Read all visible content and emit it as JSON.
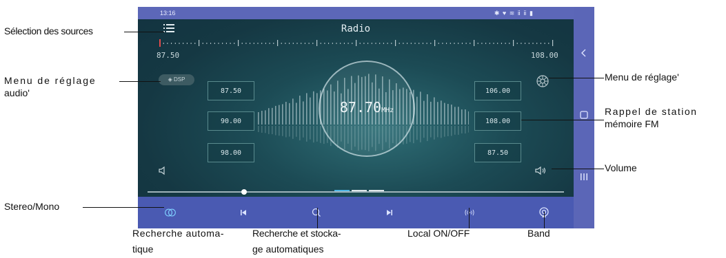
{
  "status": {
    "time": "13:16",
    "icons": "✱ ♥ ≋ ⅱ ⅱ ▮"
  },
  "app": {
    "title": "Radio",
    "scale_min": "87.50",
    "scale_max": "108.00",
    "dsp_label": "DSP",
    "frequency": "87.70",
    "frequency_unit": "MHz"
  },
  "presets_left": [
    "87.50",
    "90.00",
    "98.00"
  ],
  "presets_right": [
    "106.00",
    "108.00",
    "87.50"
  ],
  "annotations": {
    "sources": "Sélection des sources",
    "audio_line1": "Menu de réglage",
    "audio_line2": "audio'",
    "settings": "Menu de réglage'",
    "memory_line1": "Rappel de station",
    "memory_line2": "mémoire FM",
    "volume": "Volume",
    "stereo": "Stereo/Mono",
    "seek_line1": "Recherche automa-",
    "seek_line2": "tique",
    "scan_line1": "Recherche et stocka-",
    "scan_line2": "ge automatiques",
    "local": "Local ON/OFF",
    "band": "Band"
  },
  "colors": {
    "status_bar": "#5c67b8",
    "bottom_bar": "#4a5ab2",
    "accent": "#4fb6e6"
  },
  "icon_names": [
    "menu-icon",
    "settings-gear-icon",
    "volume-down-icon",
    "volume-up-icon",
    "stereo-mono-icon",
    "seek-back-icon",
    "search-icon",
    "seek-forward-icon",
    "local-signal-icon",
    "band-icon",
    "chevron-left-icon",
    "square-icon",
    "recents-icon"
  ]
}
